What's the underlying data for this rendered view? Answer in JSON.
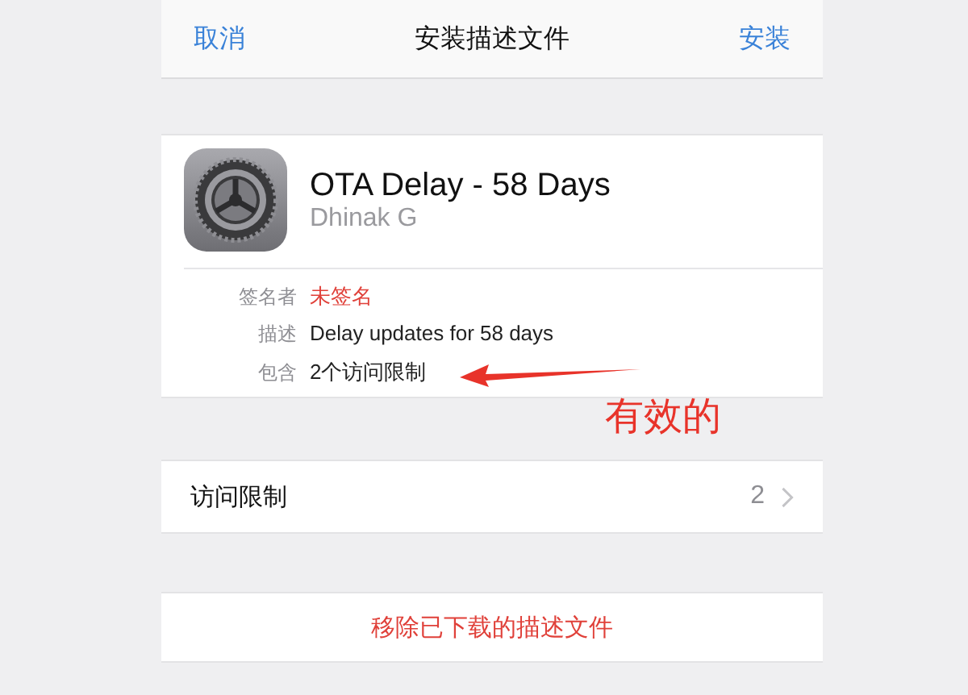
{
  "nav_bar": {
    "cancel": "取消",
    "title": "安装描述文件",
    "install": "安装"
  },
  "profile": {
    "name": "OTA Delay - 58 Days",
    "author": "Dhinak G",
    "details": [
      {
        "label": "签名者",
        "value": "未签名",
        "color": "#e0413a"
      },
      {
        "label": "描述",
        "value": "Delay updates for 58 days",
        "color": "#222222"
      },
      {
        "label": "包含",
        "value": "2个访问限制",
        "color": "#222222"
      }
    ]
  },
  "annotation": {
    "text": "有效的"
  },
  "restrictions_row": {
    "label": "访问限制",
    "count": "2"
  },
  "remove_button": "移除已下载的描述文件"
}
